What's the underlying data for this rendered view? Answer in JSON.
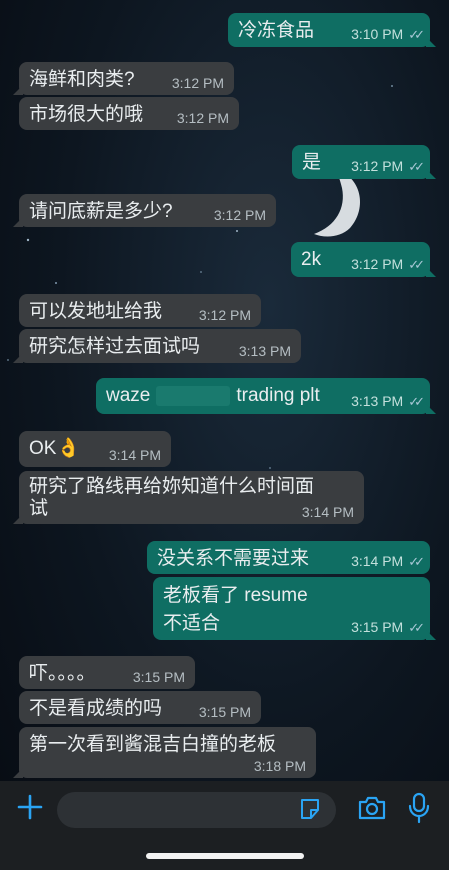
{
  "messages": [
    {
      "dir": "out",
      "text": "冷冻食品",
      "time": "3:10 PM",
      "read": true
    },
    {
      "dir": "in",
      "text": "海鲜和肉类?",
      "time": "3:12 PM"
    },
    {
      "dir": "in",
      "text": "市场很大的哦",
      "time": "3:12 PM"
    },
    {
      "dir": "out",
      "text": "是",
      "time": "3:12 PM",
      "read": true
    },
    {
      "dir": "in",
      "text": "请问底薪是多少?",
      "time": "3:12 PM"
    },
    {
      "dir": "out",
      "text": "2k",
      "time": "3:12 PM",
      "read": true
    },
    {
      "dir": "in",
      "text": "可以发地址给我",
      "time": "3:12 PM"
    },
    {
      "dir": "in",
      "text": "研究怎样过去面试吗",
      "time": "3:13 PM"
    },
    {
      "dir": "out",
      "text_before": "waze",
      "text_after": "trading plt",
      "time": "3:13 PM",
      "read": true,
      "redacted": true
    },
    {
      "dir": "in",
      "text": "OK👌",
      "time": "3:14 PM"
    },
    {
      "dir": "in",
      "line1": "研究了路线再给妳知道什么时间面",
      "line2": "试",
      "time": "3:14 PM"
    },
    {
      "dir": "out",
      "text": "没关系不需要过来",
      "time": "3:14 PM",
      "read": true
    },
    {
      "dir": "out",
      "line1": "老板看了 resume",
      "line2": "不适合",
      "time": "3:15 PM",
      "read": true
    },
    {
      "dir": "in",
      "text": "吓。。。。",
      "time": "3:15 PM"
    },
    {
      "dir": "in",
      "text": "不是看成绩的吗",
      "time": "3:15 PM"
    },
    {
      "dir": "in",
      "text": "第一次看到酱混吉白撞的老板",
      "time": "3:18 PM"
    }
  ],
  "read_ticks": "✓✓",
  "colors": {
    "incoming": "#3a3d40",
    "outgoing": "#0f6e63",
    "accent": "#2aa4f4"
  },
  "icons": [
    "plus-icon",
    "sticker-icon",
    "camera-icon",
    "microphone-icon"
  ]
}
